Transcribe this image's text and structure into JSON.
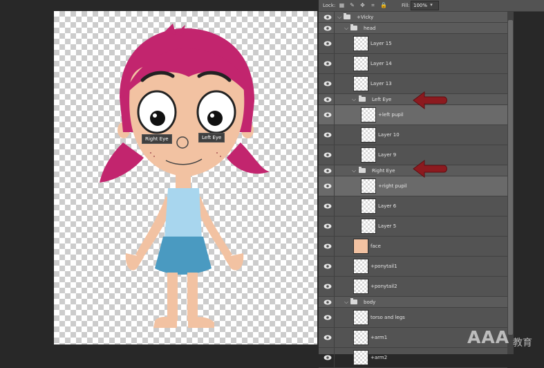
{
  "canvas": {
    "labels": {
      "right_eye": "Right Eye",
      "left_eye": "Left Eye"
    }
  },
  "panel": {
    "lock_label": "Lock:",
    "fill_label": "Fill:",
    "fill_value": "100%",
    "layers": [
      {
        "name": "+Vicky",
        "type": "group",
        "expanded": true
      },
      {
        "name": "head",
        "type": "group",
        "expanded": true
      },
      {
        "name": "Layer 15",
        "type": "layer"
      },
      {
        "name": "Layer 14",
        "type": "layer"
      },
      {
        "name": "Layer 13",
        "type": "layer"
      },
      {
        "name": "Left Eye",
        "type": "group",
        "expanded": true
      },
      {
        "name": "+left pupil",
        "type": "layer",
        "selected": true
      },
      {
        "name": "Layer 10",
        "type": "layer"
      },
      {
        "name": "Layer 9",
        "type": "layer"
      },
      {
        "name": "Right Eye",
        "type": "group",
        "expanded": true
      },
      {
        "name": "+right pupil",
        "type": "layer",
        "selected": true
      },
      {
        "name": "Layer 6",
        "type": "layer"
      },
      {
        "name": "Layer 5",
        "type": "layer"
      },
      {
        "name": "face",
        "type": "layer"
      },
      {
        "name": "+ponytail1",
        "type": "layer"
      },
      {
        "name": "+ponytail2",
        "type": "layer"
      },
      {
        "name": "body",
        "type": "group",
        "expanded": true
      },
      {
        "name": "torso and legs",
        "type": "layer"
      },
      {
        "name": "+arm1",
        "type": "layer"
      },
      {
        "name": "+arm2",
        "type": "layer"
      }
    ]
  },
  "watermark": {
    "text": "AAA",
    "cn": "教育"
  },
  "colors": {
    "hair": "#c2256e",
    "skin": "#f2c2a2",
    "shirt": "#a8d6ee",
    "skirt": "#4a9ac1",
    "arrow": "#8c1a1f"
  }
}
